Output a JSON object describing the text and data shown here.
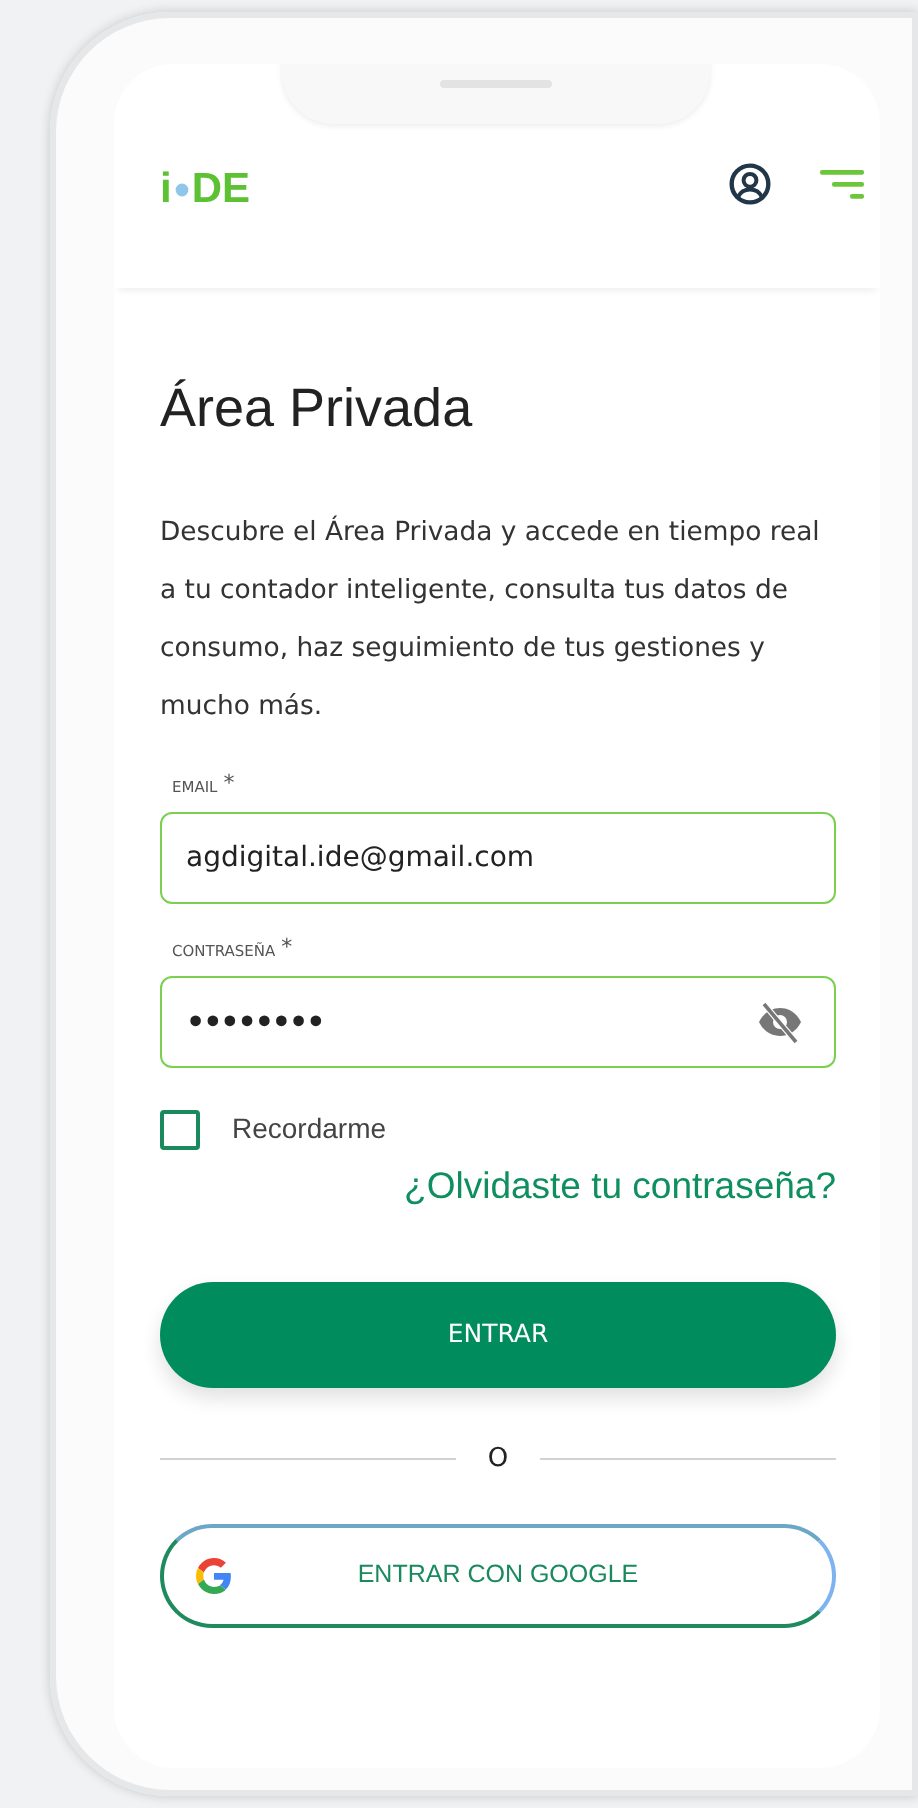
{
  "header": {
    "logo": {
      "left": "i",
      "right": "DE"
    }
  },
  "title": "Área Privada",
  "intro": "Descubre el Área Privada y accede en tiempo real a tu contador inteligente, consulta tus datos de consumo, haz seguimiento de tus gestiones y mucho más.",
  "fields": [
    {
      "kind": "text",
      "label": "EMAIL",
      "required_mark": "*",
      "value": "agdigital.ide@gmail.com"
    },
    {
      "kind": "password",
      "label": "CONTRASEÑA",
      "required_mark": "*",
      "value": "••••••••"
    }
  ],
  "remember": {
    "label": "Recordarme",
    "checked": false
  },
  "forgot_link": "¿Olvidaste tu contraseña?",
  "login_button": "ENTRAR",
  "divider_text": "O",
  "google_button": "ENTRAR CON GOOGLE"
}
